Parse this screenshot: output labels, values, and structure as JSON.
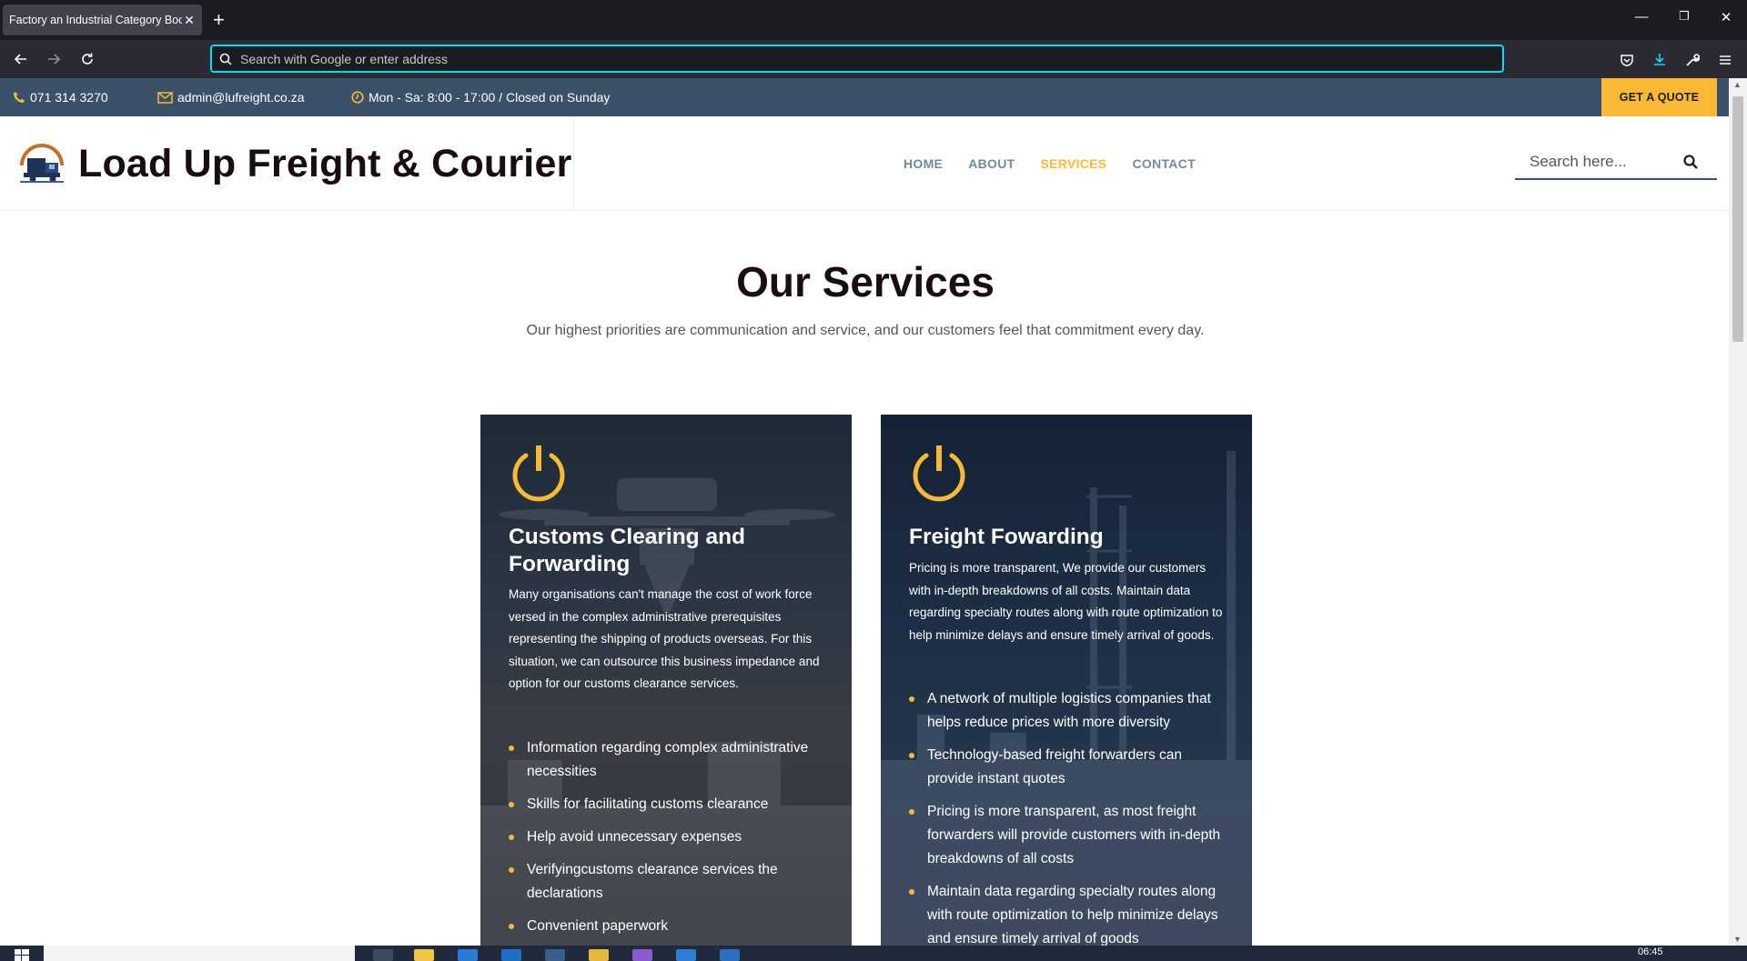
{
  "browser": {
    "tab_title": "Factory an Industrial Category Bootstrap",
    "tab_close": "✕",
    "new_tab": "+",
    "url_placeholder": "Search with Google or enter address",
    "window_controls": {
      "minimize": "—",
      "restore": "❐",
      "close": "✕"
    }
  },
  "topbar": {
    "phone": "071 314 3270",
    "email": "admin@lufreight.co.za",
    "hours": "Mon - Sa: 8:00 - 17:00 / Closed on Sunday",
    "quote_button": "GET A QUOTE"
  },
  "header": {
    "brand": "Load Up Freight & Courier",
    "nav": [
      "HOME",
      "ABOUT",
      "SERVICES",
      "CONTACT"
    ],
    "active_nav": "SERVICES",
    "search_placeholder": "Search here..."
  },
  "main": {
    "title": "Our Services",
    "subtitle": "Our highest priorities are communication and service, and our customers feel that commitment every day.",
    "cards": [
      {
        "title": "Customs Clearing and Forwarding",
        "text": "Many organisations can't manage the cost of work force versed in the complex administrative prerequisites representing the shipping of products overseas. For this situation, we can outsource this business impedance and option for our customs clearance services.",
        "items": [
          "Information regarding complex administrative necessities",
          "Skills for facilitating customs clearance",
          "Help avoid unnecessary expenses",
          "Verifyingcustoms clearance services the declarations",
          "Convenient paperwork"
        ]
      },
      {
        "title": "Freight Fowarding",
        "text": "Pricing is more transparent, We provide our customers with in-depth breakdowns of all costs. Maintain data regarding specialty routes along with route optimization to help minimize delays and ensure timely arrival of goods.",
        "items": [
          "A network of multiple logistics companies that helps reduce prices with more diversity",
          "Technology-based freight forwarders can provide instant quotes",
          "Pricing is more transparent, as most freight forwarders will provide customers with in-depth breakdowns of all costs",
          "Maintain data regarding specialty routes along with route optimization to help minimize delays and ensure timely arrival of goods"
        ]
      }
    ]
  },
  "taskbar": {
    "clock": "06:45"
  },
  "colors": {
    "accent": "#f9b934",
    "topbar": "#3b5069",
    "nav_text": "#748a9c",
    "brand_text": "#1a0d12",
    "browser_chrome": "#1c1b22",
    "url_focus": "#00ddff"
  }
}
